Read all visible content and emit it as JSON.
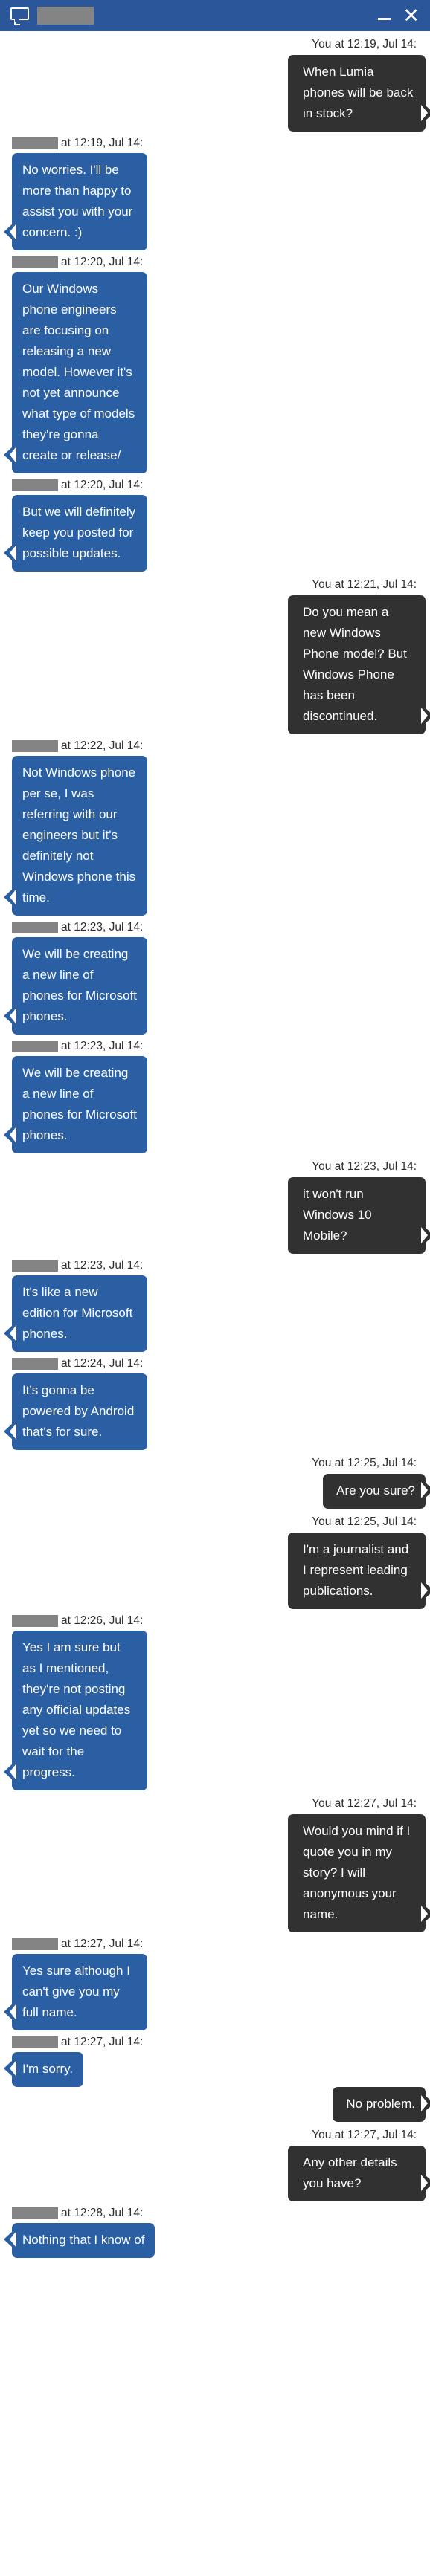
{
  "window": {
    "icon": "chat-bubble-icon",
    "title_redacted": true,
    "minimize_label": "–",
    "close_label": "×",
    "header_color": "#2b5699"
  },
  "colors": {
    "header": "#2b5699",
    "agent_bubble": "#2b5fa4",
    "user_bubble": "#313131",
    "redaction": "#848484",
    "background": "#ffffff",
    "meta_text": "#2f2f2f"
  },
  "conversation": {
    "self_label": "You",
    "messages": [
      {
        "side": "right",
        "sender": "You",
        "redacted": false,
        "meta": "You at 12:19, Jul 14:",
        "text": "When Lumia phones will be back in stock?",
        "width": "w185"
      },
      {
        "side": "left",
        "sender": "agent",
        "redacted": true,
        "meta": "at 12:19, Jul 14:",
        "text": "No worries. I'll be more than happy to assist you with your concern. :)",
        "width": "w182"
      },
      {
        "side": "left",
        "sender": "agent",
        "redacted": true,
        "meta": "at 12:20, Jul 14:",
        "text": "Our Windows phone engineers are focusing on releasing a new model. However it's not yet announce what type of models they're gonna create or release/",
        "width": "w182"
      },
      {
        "side": "left",
        "sender": "agent",
        "redacted": true,
        "meta": "at 12:20, Jul 14:",
        "text": "But we will definitely keep you posted for possible updates.",
        "width": "w182"
      },
      {
        "side": "right",
        "sender": "You",
        "redacted": false,
        "meta": "You at 12:21, Jul 14:",
        "text": "Do you mean a new Windows Phone model? But Windows Phone has been discontinued.",
        "width": "w185"
      },
      {
        "side": "left",
        "sender": "agent",
        "redacted": true,
        "meta": "at 12:22, Jul 14:",
        "text": "Not Windows phone per se, I was referring with our engineers but it's definitely not Windows phone this time.",
        "width": "w182"
      },
      {
        "side": "left",
        "sender": "agent",
        "redacted": true,
        "meta": "at 12:23, Jul 14:",
        "text": "We will be creating a new line of phones for Microsoft phones.",
        "width": "w182"
      },
      {
        "side": "left",
        "sender": "agent",
        "redacted": true,
        "meta": "at 12:23, Jul 14:",
        "text": "We will be creating a new line of phones for Microsoft phones.",
        "width": "w182"
      },
      {
        "side": "right",
        "sender": "You",
        "redacted": false,
        "meta": "You at 12:23, Jul 14:",
        "text": "it won't run Windows 10 Mobile?",
        "width": "w185"
      },
      {
        "side": "left",
        "sender": "agent",
        "redacted": true,
        "meta": "at 12:23, Jul 14:",
        "text": "It's like a new edition for Microsoft phones.",
        "width": "w182"
      },
      {
        "side": "left",
        "sender": "agent",
        "redacted": true,
        "meta": "at 12:24, Jul 14:",
        "text": "It's gonna be powered by Android that's for sure.",
        "width": "w182"
      },
      {
        "side": "right",
        "sender": "You",
        "redacted": false,
        "meta": "You at 12:25, Jul 14:",
        "text": "Are you sure?",
        "width": "fit"
      },
      {
        "side": "right",
        "sender": "You",
        "redacted": false,
        "meta": "You at 12:25, Jul 14:",
        "text": "I'm a journalist and I represent leading publications.",
        "width": "w185"
      },
      {
        "side": "left",
        "sender": "agent",
        "redacted": true,
        "meta": "at 12:26, Jul 14:",
        "text": "Yes I am sure but as I mentioned, they're not posting any official updates yet so we need to wait for the progress.",
        "width": "w182"
      },
      {
        "side": "right",
        "sender": "You",
        "redacted": false,
        "meta": "You at 12:27, Jul 14:",
        "text": "Would you mind if I quote you in my story? I will anonymous your name.",
        "width": "w185"
      },
      {
        "side": "left",
        "sender": "agent",
        "redacted": true,
        "meta": "at 12:27, Jul 14:",
        "text": "Yes sure although I can't give you my full name.",
        "width": "w182"
      },
      {
        "side": "left",
        "sender": "agent",
        "redacted": true,
        "meta": "at 12:27, Jul 14:",
        "text": "I'm sorry.",
        "width": "fit"
      },
      {
        "side": "right",
        "sender": "You",
        "redacted": false,
        "meta": "",
        "text": "No problem.",
        "width": "fit"
      },
      {
        "side": "right",
        "sender": "You",
        "redacted": false,
        "meta": "You at 12:27, Jul 14:",
        "text": "Any other details you have?",
        "width": "w185"
      },
      {
        "side": "left",
        "sender": "agent",
        "redacted": true,
        "meta": "at 12:28, Jul 14:",
        "text": "Nothing that I know of",
        "width": "fit"
      }
    ]
  }
}
